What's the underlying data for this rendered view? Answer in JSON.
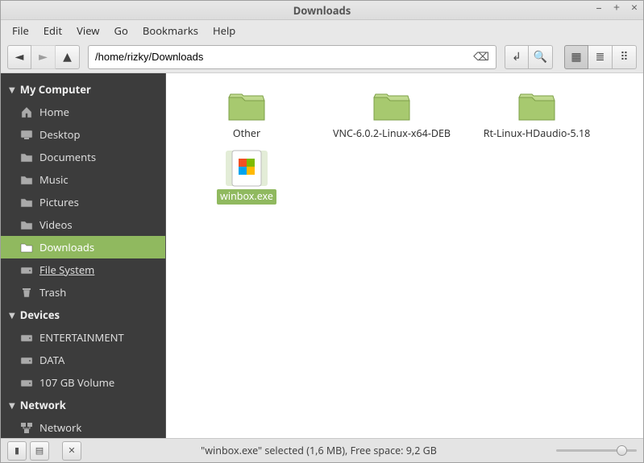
{
  "window": {
    "title": "Downloads"
  },
  "window_controls": {
    "minimize": "–",
    "maximize": "+",
    "close": "×"
  },
  "menubar": [
    "File",
    "Edit",
    "View",
    "Go",
    "Bookmarks",
    "Help"
  ],
  "toolbar": {
    "back": "←",
    "forward": "→",
    "up": "↑",
    "path": "/home/rizky/Downloads",
    "clear": "⌫",
    "toggle_location": "↲",
    "search": "🔍",
    "view_icons": "▦",
    "view_list": "≣",
    "view_compact": "⠿"
  },
  "sidebar": {
    "sections": [
      {
        "name": "My Computer",
        "items": [
          {
            "label": "Home",
            "icon": "home"
          },
          {
            "label": "Desktop",
            "icon": "desktop"
          },
          {
            "label": "Documents",
            "icon": "folder"
          },
          {
            "label": "Music",
            "icon": "folder"
          },
          {
            "label": "Pictures",
            "icon": "folder"
          },
          {
            "label": "Videos",
            "icon": "folder"
          },
          {
            "label": "Downloads",
            "icon": "folder",
            "active": true
          },
          {
            "label": "File System",
            "icon": "drive",
            "underline": true
          },
          {
            "label": "Trash",
            "icon": "trash"
          }
        ]
      },
      {
        "name": "Devices",
        "items": [
          {
            "label": "ENTERTAINMENT",
            "icon": "drive"
          },
          {
            "label": "DATA",
            "icon": "drive"
          },
          {
            "label": "107 GB Volume",
            "icon": "drive"
          }
        ]
      },
      {
        "name": "Network",
        "items": [
          {
            "label": "Network",
            "icon": "network"
          }
        ]
      }
    ]
  },
  "content": {
    "items": [
      {
        "name": "Other",
        "type": "folder"
      },
      {
        "name": "VNC-6.0.2-Linux-x64-DEB",
        "type": "folder"
      },
      {
        "name": "Rt-Linux-HDaudio-5.18",
        "type": "folder"
      },
      {
        "name": "winbox.exe",
        "type": "exe",
        "selected": true
      }
    ]
  },
  "statusbar": {
    "text": "\"winbox.exe\" selected (1,6 MB), Free space: 9,2 GB"
  }
}
